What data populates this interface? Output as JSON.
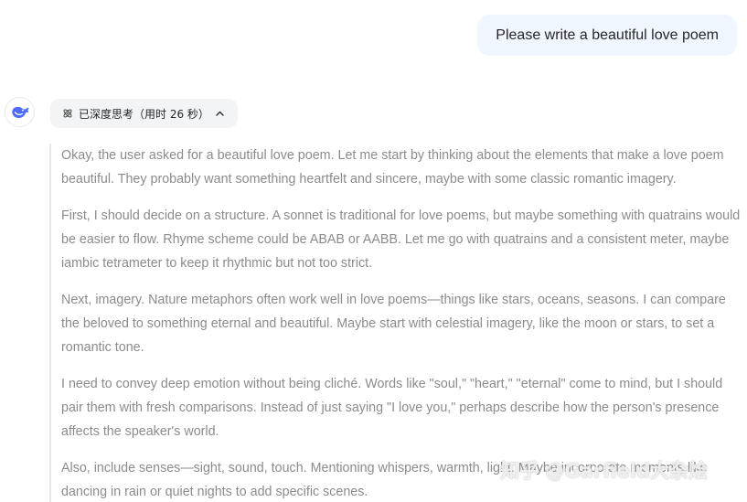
{
  "user_message": "Please write a beautiful love poem",
  "assistant": {
    "avatar_icon": "deepseek-whale-icon",
    "thinking_toggle": {
      "label": "已深度思考（用时 26 秒）",
      "icon": "atom-icon",
      "chevron": "chevron-up-icon"
    },
    "thinking_paragraphs": [
      "Okay, the user asked for a beautiful love poem. Let me start by thinking about the elements that make a love poem beautiful. They probably want something heartfelt and sincere, maybe with some classic romantic imagery.",
      "First, I should decide on a structure. A sonnet is traditional for love poems, but maybe something with quatrains would be easier to flow. Rhyme scheme could be ABAB or AABB. Let me go with quatrains and a consistent meter, maybe iambic tetrameter to keep it rhythmic but not too strict.",
      "Next, imagery. Nature metaphors often work well in love poems—things like stars, oceans, seasons. I can compare the beloved to something eternal and beautiful. Maybe start with celestial imagery, like the moon or stars, to set a romantic tone.",
      "I need to convey deep emotion without being cliché. Words like \"soul,\" \"heart,\" \"eternal\" come to mind, but I should pair them with fresh comparisons. Instead of just saying \"I love you,\" perhaps describe how the person's presence affects the speaker's world.",
      "Also, include senses—sight, sound, touch. Mentioning whispers, warmth, light. Maybe incorporate moments like dancing in rain or quiet nights to add specific scenes."
    ]
  },
  "watermark": "知乎 @Garfield大杂烩",
  "colors": {
    "user_bubble_bg": "#eff6ff",
    "thinking_text": "#8b8b8b",
    "pill_bg": "#f3f4f6",
    "brand_blue": "#4d6bfe"
  }
}
